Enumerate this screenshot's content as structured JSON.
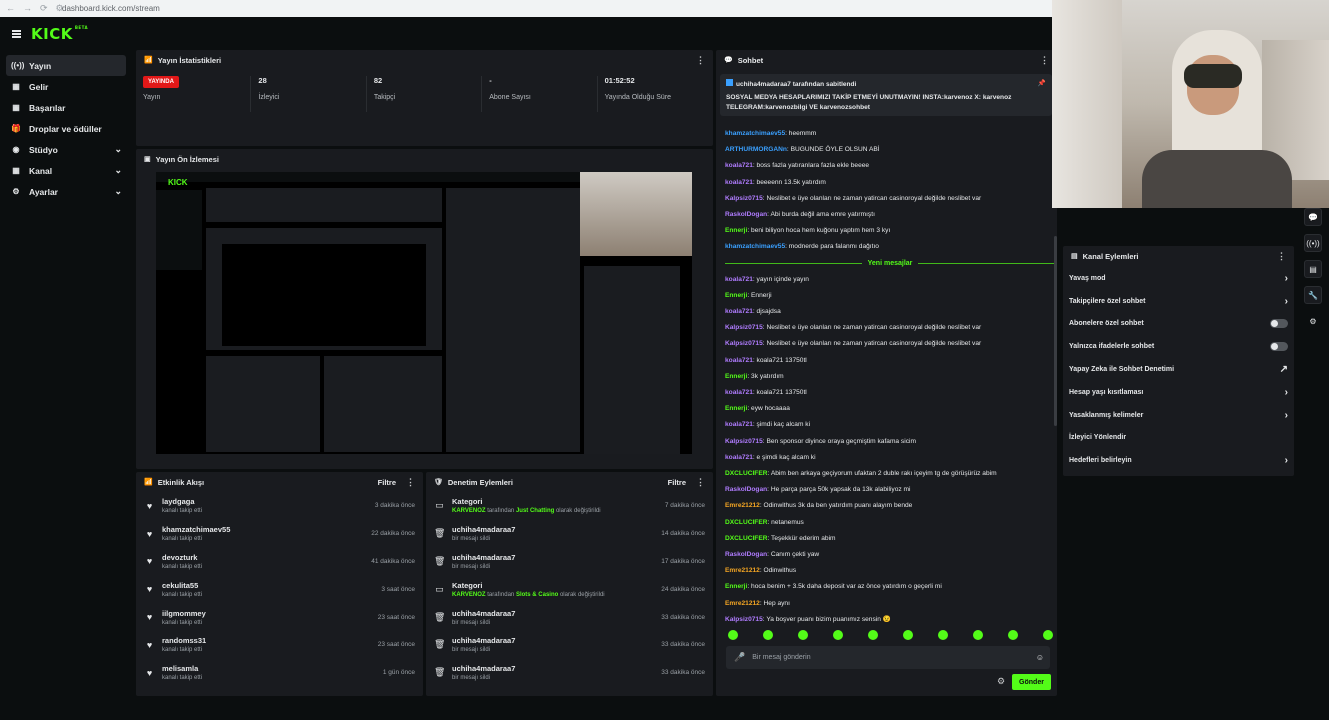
{
  "browser": {
    "url": "dashboard.kick.com/stream",
    "nav_icons": [
      "back-arrow-icon",
      "forward-arrow-icon",
      "reload-icon",
      "site-info-icon"
    ]
  },
  "brand": {
    "logo": "KICK",
    "beta": "BETA",
    "accent": "#53fc18"
  },
  "sidebar": {
    "items": [
      {
        "label": "Yayın",
        "icon": "broadcast-icon",
        "active": true
      },
      {
        "label": "Gelir",
        "icon": "revenue-icon"
      },
      {
        "label": "Başarılar",
        "icon": "achievements-icon"
      },
      {
        "label": "Droplar ve ödüller",
        "icon": "gift-icon"
      },
      {
        "label": "Stüdyo",
        "icon": "studio-icon",
        "expand": "chevron-down-icon"
      },
      {
        "label": "Kanal",
        "icon": "channel-icon",
        "expand": "chevron-down-icon"
      },
      {
        "label": "Ayarlar",
        "icon": "gear-icon",
        "expand": "chevron-down-icon"
      }
    ]
  },
  "stats_panel": {
    "title": "Yayın İstatistikleri",
    "live_badge": "YAYINDA",
    "items": [
      {
        "value": "",
        "label": "Yayın"
      },
      {
        "value": "28",
        "label": "İzleyici"
      },
      {
        "value": "82",
        "label": "Takipçi"
      },
      {
        "value": "-",
        "label": "Abone Sayısı"
      },
      {
        "value": "01:52:52",
        "label": "Yayında Olduğu Süre"
      }
    ]
  },
  "preview_panel": {
    "title": "Yayın Ön İzlemesi"
  },
  "activity_feed": {
    "title": "Etkinlik Akışı",
    "filter": "Filtre",
    "rows": [
      {
        "name": "laydgaga",
        "sub": "kanalı takip etti",
        "time": "3 dakika önce"
      },
      {
        "name": "khamzatchimaev55",
        "sub": "kanalı takip etti",
        "time": "22 dakika önce"
      },
      {
        "name": "devozturk",
        "sub": "kanalı takip etti",
        "time": "41 dakika önce"
      },
      {
        "name": "cekulita55",
        "sub": "kanalı takip etti",
        "time": "3 saat önce"
      },
      {
        "name": "iilgmommey",
        "sub": "kanalı takip etti",
        "time": "23 saat önce"
      },
      {
        "name": "randomss31",
        "sub": "kanalı takip etti",
        "time": "23 saat önce"
      },
      {
        "name": "melisamla",
        "sub": "kanalı takip etti",
        "time": "1 gün önce"
      }
    ]
  },
  "moderation": {
    "title": "Denetim Eylemleri",
    "filter": "Filtre",
    "rows": [
      {
        "icon": "category-icon",
        "name": "Kategori",
        "who": "KARVENOZ",
        "mid": "tarafından",
        "what": "Just Chatting",
        "end": "olarak değiştirildi",
        "time": "7 dakika önce"
      },
      {
        "icon": "trash-icon",
        "name": "uchiha4madaraa7",
        "plain": "bir mesajı sildi",
        "time": "14 dakika önce"
      },
      {
        "icon": "trash-icon",
        "name": "uchiha4madaraa7",
        "plain": "bir mesajı sildi",
        "time": "17 dakika önce"
      },
      {
        "icon": "category-icon",
        "name": "Kategori",
        "who": "KARVENOZ",
        "mid": "tarafından",
        "what": "Slots & Casino",
        "end": "olarak değiştirildi",
        "time": "24 dakika önce"
      },
      {
        "icon": "trash-icon",
        "name": "uchiha4madaraa7",
        "plain": "bir mesajı sildi",
        "time": "33 dakika önce"
      },
      {
        "icon": "trash-icon",
        "name": "uchiha4madaraa7",
        "plain": "bir mesajı sildi",
        "time": "33 dakika önce"
      },
      {
        "icon": "trash-icon",
        "name": "uchiha4madaraa7",
        "plain": "bir mesajı sildi",
        "time": "33 dakika önce"
      }
    ]
  },
  "chat": {
    "title": "Sohbet",
    "pinned_by": "uchiha4madaraa7 tarafından sabitlendi",
    "pinned_text": "SOSYAL MEDYA HESAPLARIMIZI TAKİP ETMEYİ UNUTMAYIN! INSTA:karvenoz X: karvenoz TELEGRAM:karvenozbilgi VE karvenozsohbet",
    "new_messages": "Yeni mesajlar",
    "messages_before": [
      {
        "user": "khamzatchimaev55",
        "color": "#3aa0ff",
        "text": "heemmm"
      },
      {
        "user": "ARTHURMORGANn",
        "color": "#3aa0ff",
        "text": "BUGUNDE ÖYLE OLSUN ABİ"
      },
      {
        "user": "koala721",
        "color": "#b07cff",
        "text": "boss fazla yatıranlara fazla ekle beeee"
      },
      {
        "user": "koala721",
        "color": "#b07cff",
        "text": "beeeenn 13.5k yatırdım"
      },
      {
        "user": "Kalpsiz0715",
        "color": "#b07cff",
        "text": "Neslibet e üye olanları ne zaman yatircan casinoroyal değilde neslibet var"
      },
      {
        "user": "RaskolDogan",
        "color": "#b07cff",
        "text": "Abi burda değil ama emre yatırmıştı"
      },
      {
        "user": "Ennerji",
        "color": "#53fc18",
        "text": "beni biliyon hoca hem kuğonu yaptım hem 3 kyı"
      },
      {
        "user": "khamzatchimaev55",
        "color": "#3aa0ff",
        "text": "modnerde para falanmı dağıtıo"
      }
    ],
    "messages_after": [
      {
        "user": "koala721",
        "color": "#b07cff",
        "text": "yayın içinde yayın"
      },
      {
        "user": "Ennerji",
        "color": "#53fc18",
        "text": "Ennerji"
      },
      {
        "user": "koala721",
        "color": "#b07cff",
        "text": "djsajdsa"
      },
      {
        "user": "Kalpsiz0715",
        "color": "#b07cff",
        "text": "Neslibet e üye olanları ne zaman yatircan casinoroyal değilde neslibet var"
      },
      {
        "user": "Kalpsiz0715",
        "color": "#b07cff",
        "text": "Neslibet e üye olanları ne zaman yatircan casinoroyal değilde neslibet var"
      },
      {
        "user": "koala721",
        "color": "#b07cff",
        "text": "koala721 13750tl"
      },
      {
        "user": "Ennerji",
        "color": "#53fc18",
        "text": "3k yatırdım"
      },
      {
        "user": "koala721",
        "color": "#b07cff",
        "text": "koala721 13750tl"
      },
      {
        "user": "Ennerji",
        "color": "#53fc18",
        "text": "eyw hocaaaa"
      },
      {
        "user": "koala721",
        "color": "#b07cff",
        "text": "şimdi kaç alcam ki"
      },
      {
        "user": "Kalpsiz0715",
        "color": "#b07cff",
        "text": "Ben sponsor diyince oraya geçmiştim kafama sicim"
      },
      {
        "user": "koala721",
        "color": "#b07cff",
        "text": "e şimdi kaç alcam ki"
      },
      {
        "user": "DXCLUCIFER",
        "color": "#53fc18",
        "text": "Abim ben arkaya geçiyorum ufaktan 2 duble rakı içeyim tg de görüşürüz abim"
      },
      {
        "user": "RaskolDogan",
        "color": "#b07cff",
        "text": "He parça parça 50k yapsak da 13k alabiliyoz mi"
      },
      {
        "user": "Emre21212",
        "color": "#f5a623",
        "text": "Odinwithus 3k da ben yatırdım puanı alayım bende"
      },
      {
        "user": "DXCLUCIFER",
        "color": "#53fc18",
        "text": "netanemus"
      },
      {
        "user": "DXCLUCIFER",
        "color": "#53fc18",
        "text": "Teşekkür ederim abim"
      },
      {
        "user": "RaskolDogan",
        "color": "#b07cff",
        "text": "Canım çekti yaw"
      },
      {
        "user": "Emre21212",
        "color": "#f5a623",
        "text": "Odinwithus"
      },
      {
        "user": "Ennerji",
        "color": "#53fc18",
        "text": "hoca benim + 3.5k daha deposit var az önce yatırdım o geçerli mi"
      },
      {
        "user": "Emre21212",
        "color": "#f5a623",
        "text": "Hep aynı"
      },
      {
        "user": "Kalpsiz0715",
        "color": "#b07cff",
        "text": "Ya boşver puanı bizim puanımız sensin 😉"
      }
    ],
    "input_placeholder": "Bir mesaj gönderin",
    "send": "Gönder"
  },
  "channel_actions": {
    "title": "Kanal Eylemleri",
    "rows": [
      {
        "label": "Yavaş mod",
        "control": "chevron-right-icon"
      },
      {
        "label": "Takipçilere özel sohbet",
        "control": "chevron-right-icon"
      },
      {
        "label": "Abonelere özel sohbet",
        "control": "toggle",
        "on": false
      },
      {
        "label": "Yalnızca ifadelerle sohbet",
        "control": "toggle",
        "on": false
      },
      {
        "label": "Yapay Zeka ile Sohbet Denetimi",
        "control": "external-link-icon"
      },
      {
        "label": "Hesap yaşı kısıtlaması",
        "control": "chevron-right-icon"
      },
      {
        "label": "Yasaklanmış kelimeler",
        "control": "chevron-right-icon"
      },
      {
        "label": "İzleyici Yönlendir",
        "control": ""
      },
      {
        "label": "Hedefleri belirleyin",
        "control": "chevron-right-icon"
      }
    ]
  },
  "right_rail": [
    "chat-bubble-icon",
    "broadcast-icon",
    "layout-icon",
    "wrench-icon",
    "settings-icon"
  ]
}
